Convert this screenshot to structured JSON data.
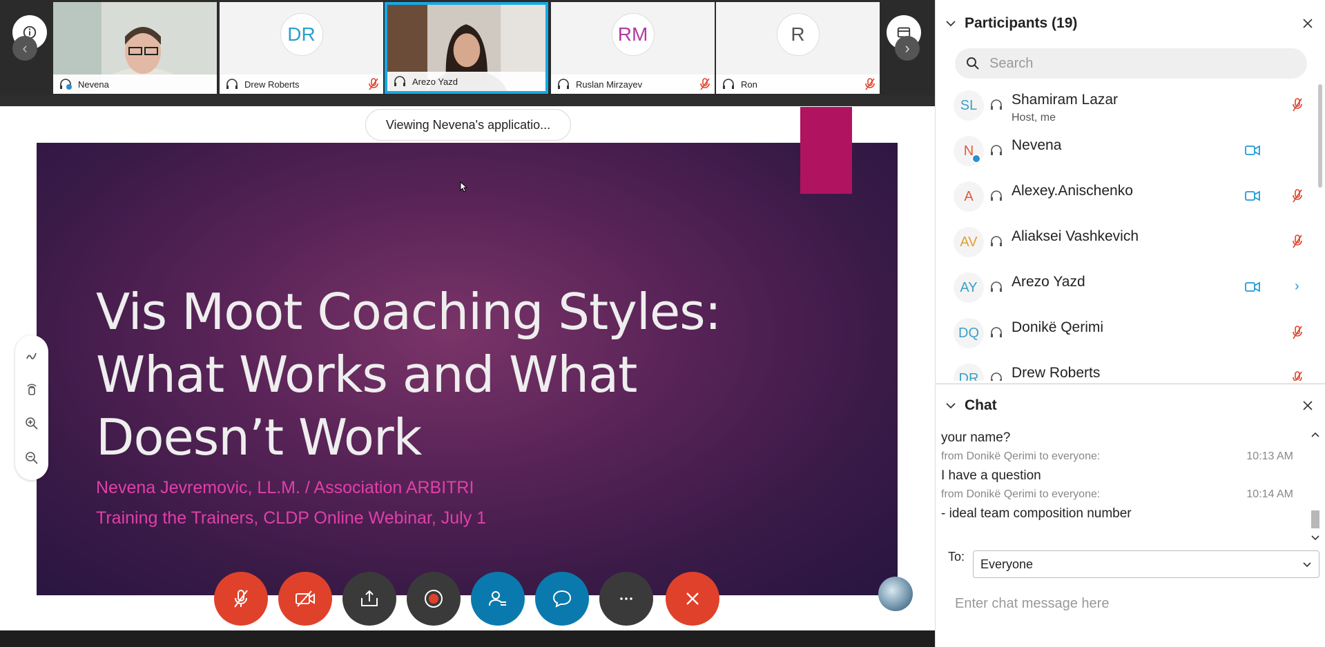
{
  "filmstrip": {
    "tiles": [
      {
        "name": "Nevena",
        "initials": ""
      },
      {
        "name": "Drew Roberts",
        "initials": "DR"
      },
      {
        "name": "Arezo Yazd",
        "initials": ""
      },
      {
        "name": "Ruslan Mirzayev",
        "initials": "RM"
      },
      {
        "name": "Ron",
        "initials": "R"
      }
    ]
  },
  "share_banner": "Viewing Nevena's applicatio...",
  "slide": {
    "title_line1": "Vis Moot Coaching Styles:",
    "title_line2": "What Works and What",
    "title_line3": "Doesn’t Work",
    "subtitle1": "Nevena Jevremovic, LL.M. / Association ARBITRI",
    "subtitle2": "Training the Trainers, CLDP Online Webinar, July 1"
  },
  "participants": {
    "title": "Participants (19)",
    "search_placeholder": "Search",
    "items": [
      {
        "initials": "SL",
        "name": "Shamiram Lazar",
        "role": "Host, me",
        "color": "#3aa0c8"
      },
      {
        "initials": "N",
        "name": "Nevena",
        "role": "",
        "color": "#e0593a"
      },
      {
        "initials": "A",
        "name": "Alexey.Anischenko",
        "role": "",
        "color": "#e0593a"
      },
      {
        "initials": "AV",
        "name": "Aliaksei Vashkevich",
        "role": "",
        "color": "#e0a030"
      },
      {
        "initials": "AY",
        "name": "Arezo Yazd",
        "role": "",
        "color": "#3aa0c8"
      },
      {
        "initials": "DQ",
        "name": "Donikë Qerimi",
        "role": "",
        "color": "#3aa0c8"
      },
      {
        "initials": "DR",
        "name": "Drew Roberts",
        "role": "",
        "color": "#3aa0c8"
      }
    ]
  },
  "chat": {
    "title": "Chat",
    "messages": [
      {
        "text": "your name?"
      },
      {
        "from": "from Donikë Qerimi to everyone:",
        "time": "10:13 AM",
        "text": "I have a question"
      },
      {
        "from": "from Donikë Qerimi to everyone:",
        "time": "10:14 AM",
        "text": "- ideal team composition number"
      }
    ],
    "to_label": "To:",
    "to_value": "Everyone",
    "input_placeholder": "Enter chat message here"
  },
  "colors": {
    "accent_blue": "#16a9e6",
    "mute_red": "#e0412b",
    "slide_pink": "#e040a8"
  }
}
